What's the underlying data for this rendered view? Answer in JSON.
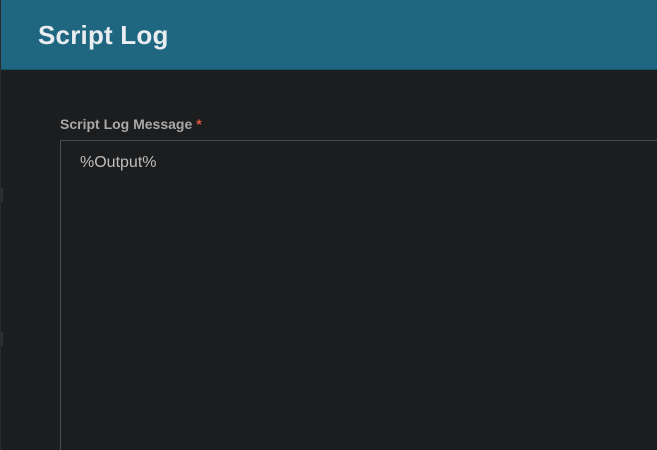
{
  "dialog": {
    "title": "Script Log"
  },
  "colors": {
    "header_bg": "#1f6680",
    "body_bg": "#1c1d1f",
    "title_text": "#e9edf0",
    "label_text": "#a9a9a9",
    "required": "#e0553f",
    "field_border": "#4a4b4d"
  },
  "form": {
    "message_field": {
      "label": "Script Log Message",
      "required_marker": "*",
      "value": "%Output%"
    }
  }
}
